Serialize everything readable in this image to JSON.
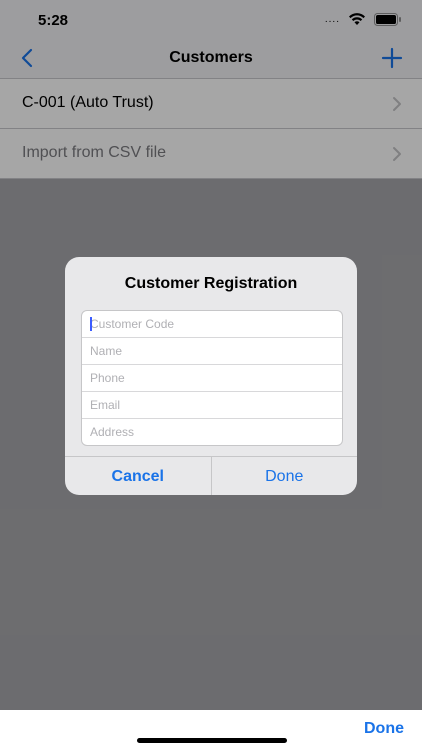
{
  "status_bar": {
    "time": "5:28",
    "signal": "....",
    "wifi_icon": "wifi-icon",
    "battery_icon": "battery-icon"
  },
  "nav": {
    "title": "Customers",
    "back_icon": "chevron-left-icon",
    "add_icon": "plus-icon",
    "accent": "#1a73e8"
  },
  "list": {
    "items": [
      {
        "label": "C-001 (Auto Trust)"
      },
      {
        "label": "Import from CSV file"
      }
    ]
  },
  "dialog": {
    "title": "Customer Registration",
    "fields": [
      {
        "placeholder": "Customer Code",
        "value": ""
      },
      {
        "placeholder": "Name",
        "value": ""
      },
      {
        "placeholder": "Phone",
        "value": ""
      },
      {
        "placeholder": "Email",
        "value": ""
      },
      {
        "placeholder": "Address",
        "value": ""
      }
    ],
    "cancel_label": "Cancel",
    "done_label": "Done"
  },
  "keyboard_toolbar": {
    "done_label": "Done"
  }
}
